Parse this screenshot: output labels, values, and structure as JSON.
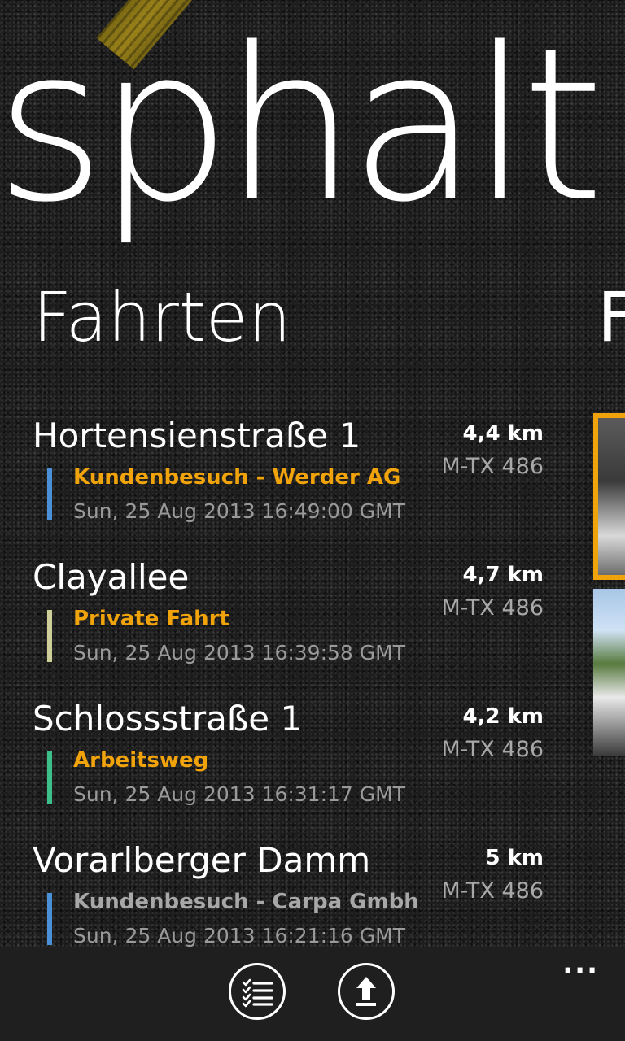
{
  "app": {
    "title": "sphalt"
  },
  "sections": {
    "current_title": "Fahrten",
    "next_title": "F"
  },
  "colors": {
    "accent": "#f0a30a",
    "secondary_text": "#9a9a9a"
  },
  "trips": [
    {
      "street": "Hortensienstraße 1",
      "distance": "4,4 km",
      "plate": "M-TX 486",
      "purpose": "Kundenbesuch - Werder AG",
      "purpose_color": "#f0a30a",
      "date": "Sun, 25 Aug 2013 16:49:00 GMT",
      "bar_color": "#4a90d9"
    },
    {
      "street": "Clayallee",
      "distance": "4,7 km",
      "plate": "M-TX 486",
      "purpose": "Private Fahrt",
      "purpose_color": "#f0a30a",
      "date": "Sun, 25 Aug 2013 16:39:58 GMT",
      "bar_color": "#cfcf9a"
    },
    {
      "street": "Schlossstraße 1",
      "distance": "4,2 km",
      "plate": "M-TX 486",
      "purpose": "Arbeitsweg",
      "purpose_color": "#f0a30a",
      "date": "Sun, 25 Aug 2013 16:31:17 GMT",
      "bar_color": "#3cc08a"
    },
    {
      "street": "Vorarlberger Damm",
      "distance": "5 km",
      "plate": "M-TX 486",
      "purpose": "Kundenbesuch - Carpa Gmbh",
      "purpose_color": "#a8a8a8",
      "date": "Sun, 25 Aug 2013 16:21:16 GMT",
      "bar_color": "#4a90d9"
    }
  ],
  "appbar": {
    "buttons": [
      {
        "icon": "checklist-icon"
      },
      {
        "icon": "upload-icon"
      }
    ],
    "more": "..."
  }
}
